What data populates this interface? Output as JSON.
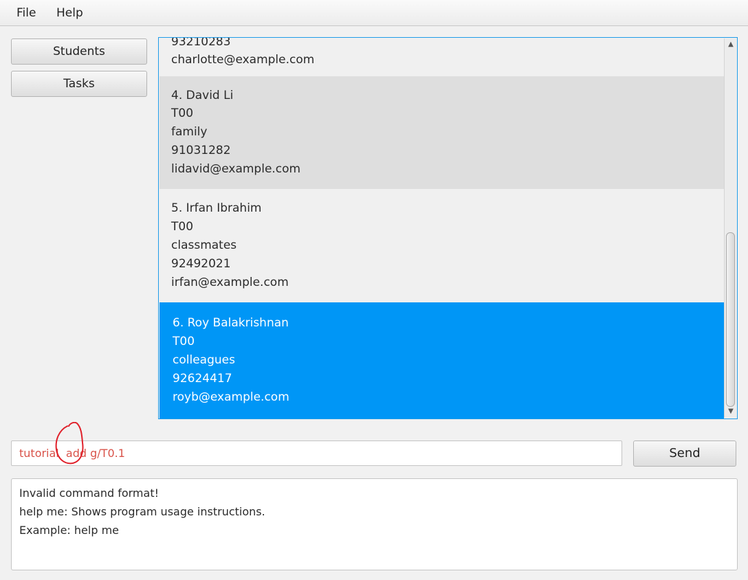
{
  "menu": {
    "file_label": "File",
    "help_label": "Help"
  },
  "sidebar": {
    "students_label": "Students",
    "tasks_label": "Tasks"
  },
  "student_list": {
    "partial_card": {
      "phone_fragment": "93210283",
      "email": "charlotte@example.com"
    },
    "cards": [
      {
        "title": "4.  David Li",
        "tutorial": "T00",
        "tag": "family",
        "phone": "91031282",
        "email": "lidavid@example.com"
      },
      {
        "title": "5.  Irfan Ibrahim",
        "tutorial": "T00",
        "tag": "classmates",
        "phone": "92492021",
        "email": "irfan@example.com"
      },
      {
        "title": "6.  Roy Balakrishnan",
        "tutorial": "T00",
        "tag": "colleagues",
        "phone": "92624417",
        "email": "royb@example.com"
      }
    ]
  },
  "command": {
    "value": "tutorial  add g/T0.1",
    "send_label": "Send"
  },
  "result": {
    "lines": [
      "Invalid command format!",
      "help me: Shows program usage instructions.",
      "Example: help me"
    ]
  },
  "colors": {
    "selection": "#0096f6",
    "error_text": "#d9534a",
    "annotation": "#e0202a",
    "panel_border": "#1e9be8"
  }
}
